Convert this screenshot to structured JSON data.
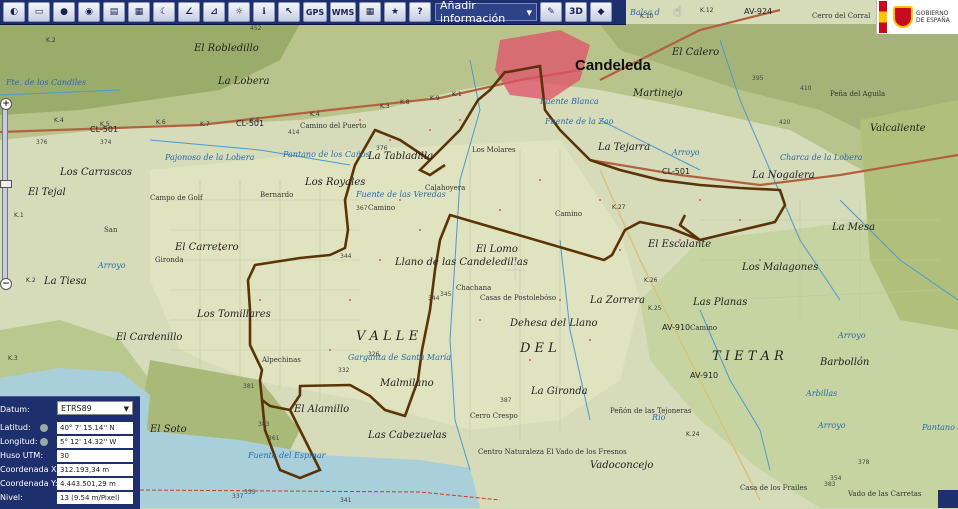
{
  "toolbar": {
    "buttons": [
      "print-icon",
      "globe-dark-icon",
      "globe-color-icon",
      "layers-icon",
      "moon-icon",
      "measure-line-icon",
      "measure-area-icon",
      "profile-icon",
      "crosshair-icon",
      "info-icon",
      "pointer-icon"
    ],
    "gps_label": "GPS",
    "wms_label": "WMS",
    "grid_icon": "grid-icon",
    "star_icon": "star-icon",
    "help_label": "?",
    "add_info_label": "Añadir información",
    "right_icons": [
      "draw-icon",
      "3d-icon",
      "terrain-icon"
    ]
  },
  "gov_logo": {
    "text_line1": "GOBIERNO",
    "text_line2": "DE ESPAÑA"
  },
  "map": {
    "town": "Candeleda",
    "labels": [
      {
        "text": "Candeleda",
        "cls": "big"
      },
      {
        "text": "Martinejo",
        "cls": "place"
      },
      {
        "text": "Fuente Blanca",
        "cls": "water"
      },
      {
        "text": "Fuente de la Zao",
        "cls": "water"
      },
      {
        "text": "La Tejarra",
        "cls": "place"
      },
      {
        "text": "Los Molares",
        "cls": "small"
      },
      {
        "text": "La Nogalera",
        "cls": "place"
      },
      {
        "text": "Charca de la Lobera",
        "cls": "water"
      },
      {
        "text": "Valcaliente",
        "cls": "place"
      },
      {
        "text": "Cerro del Corral",
        "cls": "small"
      },
      {
        "text": "El Calero",
        "cls": "place"
      },
      {
        "text": "El Robledillo",
        "cls": "place"
      },
      {
        "text": "La Lobera",
        "cls": "place"
      },
      {
        "text": "Fte. de los Candiles",
        "cls": "water"
      },
      {
        "text": "Peña del Aguila",
        "cls": "small"
      },
      {
        "text": "Pajonoso de la Lobera",
        "cls": "water"
      },
      {
        "text": "Pantano de los Caños",
        "cls": "water"
      },
      {
        "text": "La Tabladilla",
        "cls": "place"
      },
      {
        "text": "Los Carrascos",
        "cls": "place"
      },
      {
        "text": "El Tejal",
        "cls": "place"
      },
      {
        "text": "Campo de Golf",
        "cls": "small"
      },
      {
        "text": "Fuente de las Veredas",
        "cls": "water"
      },
      {
        "text": "Los Royales",
        "cls": "place"
      },
      {
        "text": "Bernardo",
        "cls": "small"
      },
      {
        "text": "San",
        "cls": "small"
      },
      {
        "text": "El Carretero",
        "cls": "place"
      },
      {
        "text": "Llano de las Candeledillas",
        "cls": "place"
      },
      {
        "text": "El Lomo",
        "cls": "place"
      },
      {
        "text": "El Escalante",
        "cls": "place"
      },
      {
        "text": "La Mesa",
        "cls": "place"
      },
      {
        "text": "Los Malagones",
        "cls": "place"
      },
      {
        "text": "La Tiesa",
        "cls": "place"
      },
      {
        "text": "Casas de Postolebóso",
        "cls": "small"
      },
      {
        "text": "La Zorrera",
        "cls": "place"
      },
      {
        "text": "Las Planas",
        "cls": "place"
      },
      {
        "text": "Los Tomillares",
        "cls": "place"
      },
      {
        "text": "Dehesa del Llano",
        "cls": "place"
      },
      {
        "text": "El Cardenillo",
        "cls": "place"
      },
      {
        "text": "V A L L E",
        "cls": "valley"
      },
      {
        "text": "D E L",
        "cls": "valley"
      },
      {
        "text": "T I E T A R",
        "cls": "valley"
      },
      {
        "text": "Alpechinas",
        "cls": "small"
      },
      {
        "text": "Barbollón",
        "cls": "place"
      },
      {
        "text": "Arbillas",
        "cls": "water"
      },
      {
        "text": "Malmilano",
        "cls": "place"
      },
      {
        "text": "La Gironda",
        "cls": "place"
      },
      {
        "text": "El Alamillo",
        "cls": "place"
      },
      {
        "text": "El Soto",
        "cls": "place"
      },
      {
        "text": "Peñón de las Tejoneras",
        "cls": "small"
      },
      {
        "text": "Las Cabezuelas",
        "cls": "place"
      },
      {
        "text": "Cerro Crespo",
        "cls": "small"
      },
      {
        "text": "Fuente del Espinar",
        "cls": "water"
      },
      {
        "text": "Centro Naturaleza El Vado de los Fresnos",
        "cls": "small"
      },
      {
        "text": "Vadoconcejo",
        "cls": "place"
      },
      {
        "text": "Casa de los Frailes",
        "cls": "small"
      },
      {
        "text": "Vado de las Carretas",
        "cls": "small"
      },
      {
        "text": "Pantano del Rincón",
        "cls": "water"
      },
      {
        "text": "Balsa d",
        "cls": "water"
      },
      {
        "text": "Chachana",
        "cls": "small"
      },
      {
        "text": "Garganta de Santa María",
        "cls": "water"
      },
      {
        "text": "Camino del Puerto",
        "cls": "small"
      },
      {
        "text": "Arroyo",
        "cls": "water"
      },
      {
        "text": "Arroyo",
        "cls": "water"
      },
      {
        "text": "Arroyo",
        "cls": "water"
      },
      {
        "text": "Arroyo",
        "cls": "water"
      },
      {
        "text": "Río",
        "cls": "water"
      },
      {
        "text": "Calahoyera",
        "cls": "small"
      },
      {
        "text": "Gironda",
        "cls": "small"
      },
      {
        "text": "Camino",
        "cls": "small"
      },
      {
        "text": "Camino",
        "cls": "small"
      },
      {
        "text": "Camino",
        "cls": "small"
      },
      {
        "text": "Camino",
        "cls": "small"
      },
      {
        "text": "Camino",
        "cls": "small"
      }
    ],
    "roads": [
      "CL-501",
      "CL-501",
      "AV-924",
      "AV-910",
      "AV-910",
      "CL-501"
    ],
    "km_marks": [
      "K.2",
      "K.1",
      "K.3",
      "K.4",
      "K.5",
      "K.27",
      "K.26",
      "K.25",
      "K.24",
      "K.1",
      "K.2",
      "K.3",
      "K.4",
      "K.5",
      "K.6",
      "K.7",
      "K.8",
      "K.9",
      "K.10",
      "K.12"
    ],
    "elevations": [
      "452",
      "420",
      "376",
      "374",
      "414",
      "376",
      "367",
      "344",
      "344",
      "345",
      "326",
      "332",
      "381",
      "361",
      "383",
      "387",
      "410",
      "395",
      "378",
      "383",
      "354",
      "341",
      "335",
      "337"
    ]
  },
  "zoom": {
    "plus": "+",
    "minus": "−"
  },
  "info_panel": {
    "datum_label": "Datum:",
    "datum_value": "ETRS89",
    "rows": [
      {
        "label": "Latitud:",
        "value": "40° 7' 15.14'' N"
      },
      {
        "label": "Longitud:",
        "value": "5° 12' 14.32'' W"
      },
      {
        "label": "Huso UTM:",
        "value": "30"
      },
      {
        "label": "Coordenada X:",
        "value": "312.193,34 m"
      },
      {
        "label": "Coordenada Y:",
        "value": "4.443.501,29 m"
      },
      {
        "label": "Nivel:",
        "value": "13 (9.54 m/Pixel)"
      }
    ]
  },
  "colors": {
    "toolbar": "#1e2f6e",
    "route": "#5b3306",
    "urban": "#e0506a",
    "water": "#a8d0dc",
    "road": "#b3603f"
  }
}
